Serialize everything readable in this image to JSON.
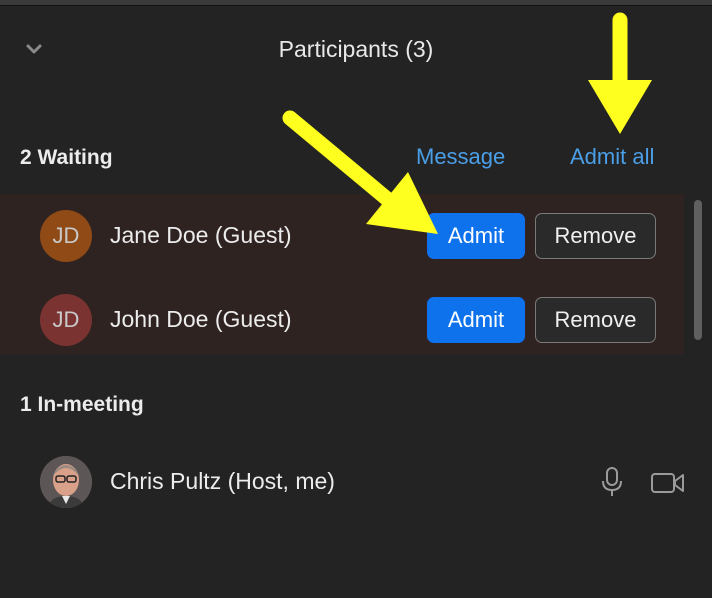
{
  "panel": {
    "title": "Participants (3)"
  },
  "waiting": {
    "heading": "2 Waiting",
    "message_link": "Message",
    "admit_all_link": "Admit all",
    "participants": [
      {
        "initials": "JD",
        "name": "Jane Doe (Guest)",
        "avatar_color": "#8f4a16",
        "admit_label": "Admit",
        "remove_label": "Remove"
      },
      {
        "initials": "JD",
        "name": "John Doe (Guest)",
        "avatar_color": "#7a3330",
        "admit_label": "Admit",
        "remove_label": "Remove"
      }
    ]
  },
  "in_meeting": {
    "heading": "1 In-meeting",
    "participants": [
      {
        "name": "Chris Pultz (Host, me)",
        "icons": [
          "microphone-icon",
          "video-camera-icon"
        ]
      }
    ]
  },
  "colors": {
    "accent": "#0e72ed",
    "link": "#4a9fe8",
    "annotation_arrow": "#ffff1f",
    "background": "#232323",
    "waiting_row_bg": "#2f2322"
  }
}
